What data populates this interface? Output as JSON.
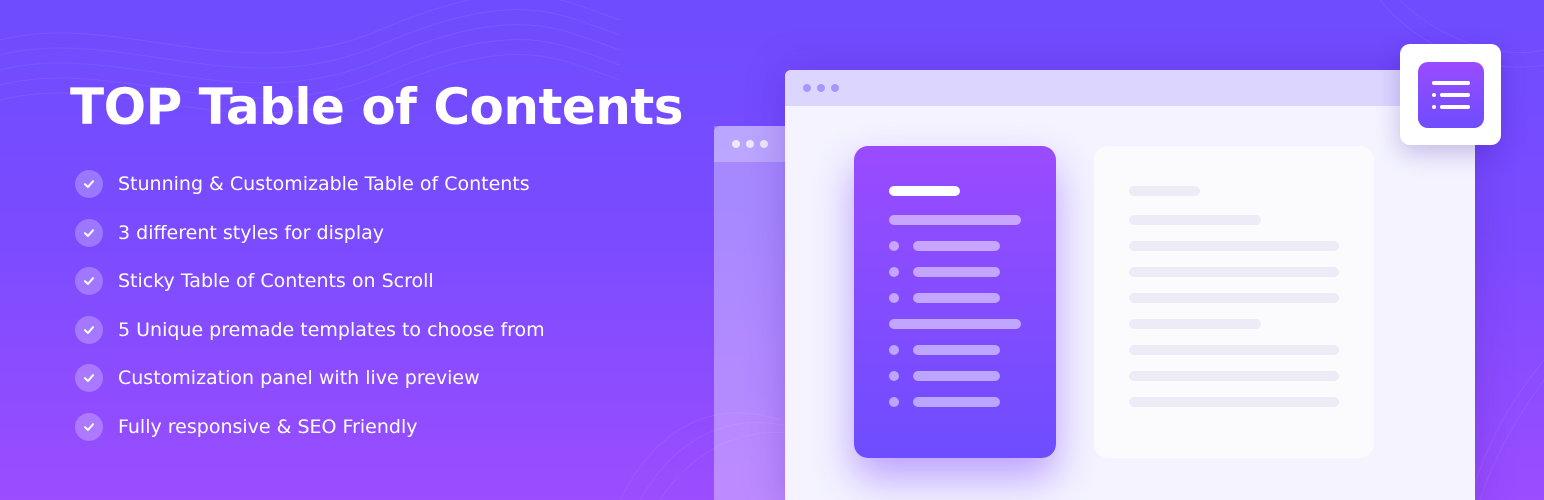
{
  "headline": "TOP Table of Contents",
  "features": [
    "Stunning & Customizable Table of Contents",
    "3 different styles for display",
    "Sticky Table of Contents on Scroll",
    "5 Unique premade templates to choose from",
    "Customization panel with live preview",
    "Fully responsive & SEO Friendly"
  ],
  "icons": {
    "feature_bullet": "check-icon",
    "app_logo": "list-icon"
  },
  "colors": {
    "background_top": "#6f4cff",
    "background_bottom": "#9b4dff",
    "accent_purple": "#8c4cff",
    "window_bar": "#dcd6ff",
    "text": "#ffffff"
  }
}
